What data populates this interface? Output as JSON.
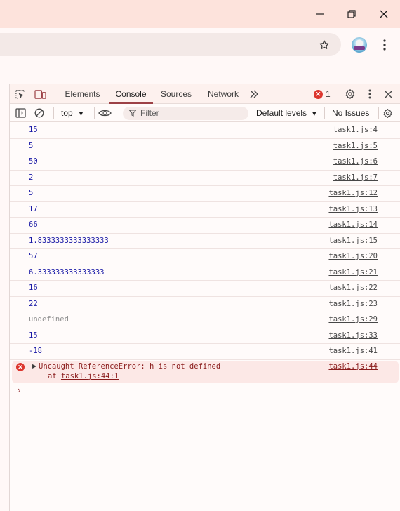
{
  "devtools": {
    "tabs": [
      {
        "label": "Elements"
      },
      {
        "label": "Console"
      },
      {
        "label": "Sources"
      },
      {
        "label": "Network"
      }
    ],
    "error_count": "1",
    "context": "top",
    "filter_placeholder": "Filter",
    "levels_label": "Default levels",
    "issues_label": "No Issues"
  },
  "console": {
    "rows": [
      {
        "value": "15",
        "source": "task1.js:4"
      },
      {
        "value": "5",
        "source": "task1.js:5"
      },
      {
        "value": "50",
        "source": "task1.js:6"
      },
      {
        "value": "2",
        "source": "task1.js:7"
      },
      {
        "value": "5",
        "source": "task1.js:12"
      },
      {
        "value": "17",
        "source": "task1.js:13"
      },
      {
        "value": "66",
        "source": "task1.js:14"
      },
      {
        "value": "1.8333333333333333",
        "source": "task1.js:15"
      },
      {
        "value": "57",
        "source": "task1.js:20"
      },
      {
        "value": "6.333333333333333",
        "source": "task1.js:21"
      },
      {
        "value": "16",
        "source": "task1.js:22"
      },
      {
        "value": "22",
        "source": "task1.js:23"
      },
      {
        "value": "undefined",
        "source": "task1.js:29"
      },
      {
        "value": "15",
        "source": "task1.js:33"
      },
      {
        "value": "-18",
        "source": "task1.js:41"
      }
    ],
    "error": {
      "message": "Uncaught ReferenceError: h is not defined",
      "at_prefix": "at ",
      "at_link": "task1.js:44:1",
      "source": "task1.js:44"
    },
    "prompt": "›"
  },
  "colors": {
    "accent": "#9c4146",
    "error": "#dc362e",
    "number": "#1a1aa6"
  }
}
